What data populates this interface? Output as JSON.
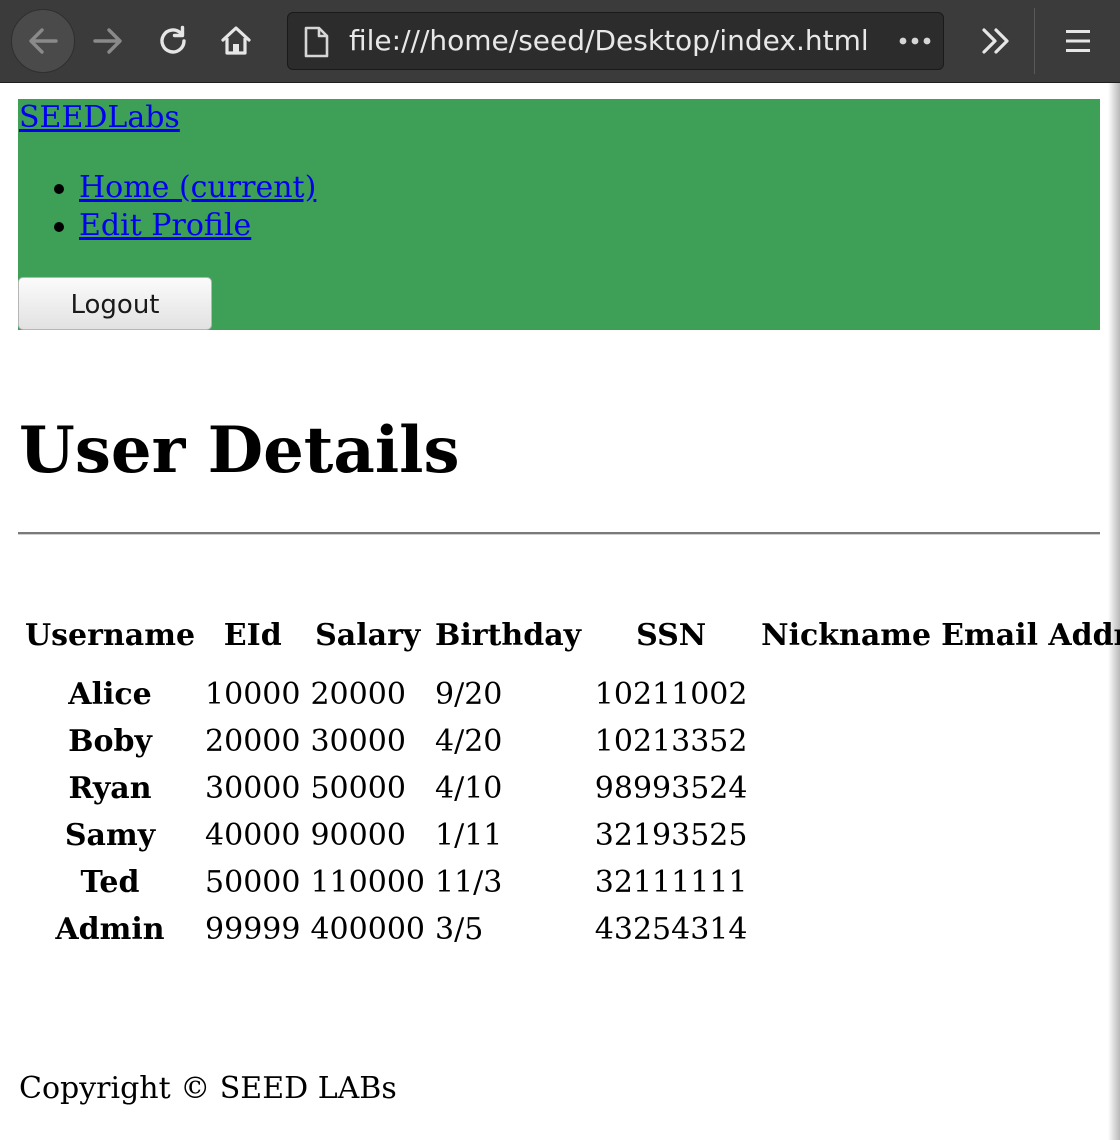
{
  "browser": {
    "url": "file:///home/seed/Desktop/index.html",
    "icons": {
      "back": "arrow-left-icon",
      "forward": "arrow-right-icon",
      "reload": "reload-icon",
      "home": "home-icon",
      "page": "page-icon",
      "more": "ellipsis-icon",
      "overflow": "double-chevron-right-icon",
      "menu": "hamburger-menu-icon"
    },
    "colors": {
      "toolbar": "#3b3b3b",
      "urlbar": "#2c2c2c"
    }
  },
  "navbar": {
    "brand": "SEEDLabs",
    "items": [
      {
        "label": "Home (current)"
      },
      {
        "label": "Edit Profile"
      }
    ],
    "logout_label": "Logout",
    "colors": {
      "background": "#3ea057",
      "link": "#0000ee"
    }
  },
  "main": {
    "title": "User Details",
    "table": {
      "headers": [
        "Username",
        "EId",
        "Salary",
        "Birthday",
        "SSN",
        "Nickname",
        "Email Address"
      ],
      "rows": [
        {
          "username": "Alice",
          "eid": "10000",
          "salary": "20000",
          "birthday": "9/20",
          "ssn": "10211002"
        },
        {
          "username": "Boby",
          "eid": "20000",
          "salary": "30000",
          "birthday": "4/20",
          "ssn": "10213352"
        },
        {
          "username": "Ryan",
          "eid": "30000",
          "salary": "50000",
          "birthday": "4/10",
          "ssn": "98993524"
        },
        {
          "username": "Samy",
          "eid": "40000",
          "salary": "90000",
          "birthday": "1/11",
          "ssn": "32193525"
        },
        {
          "username": "Ted",
          "eid": "50000",
          "salary": "110000",
          "birthday": "11/3",
          "ssn": "32111111"
        },
        {
          "username": "Admin",
          "eid": "99999",
          "salary": "400000",
          "birthday": "3/5",
          "ssn": "43254314"
        }
      ]
    }
  },
  "footer": {
    "copyright": "Copyright © SEED LABs"
  }
}
